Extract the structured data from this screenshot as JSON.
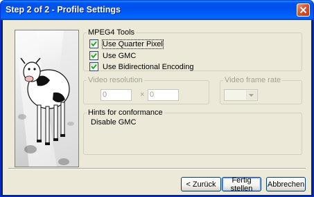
{
  "window": {
    "title": "Step 2 of 2 - Profile Settings"
  },
  "mpeg4": {
    "legend": "MPEG4 Tools",
    "options": [
      {
        "label": "Use Quarter Pixel",
        "checked": true
      },
      {
        "label": "Use GMC",
        "checked": true
      },
      {
        "label": "Use Bidirectional Encoding",
        "checked": true
      }
    ]
  },
  "resolution": {
    "legend": "Video resolution",
    "width_value": "0",
    "height_value": "0",
    "separator": "×"
  },
  "framerate": {
    "legend": "Video frame rate",
    "value": ""
  },
  "hints": {
    "legend": "Hints for conformance",
    "text": "Disable GMC"
  },
  "buttons": {
    "back": "< Zurück",
    "finish": "Fertig stellen",
    "cancel": "Abbrechen"
  },
  "colors": {
    "titlebar": "#0054e3",
    "dialog_bg": "#ece9d8",
    "close": "#d9532f"
  }
}
